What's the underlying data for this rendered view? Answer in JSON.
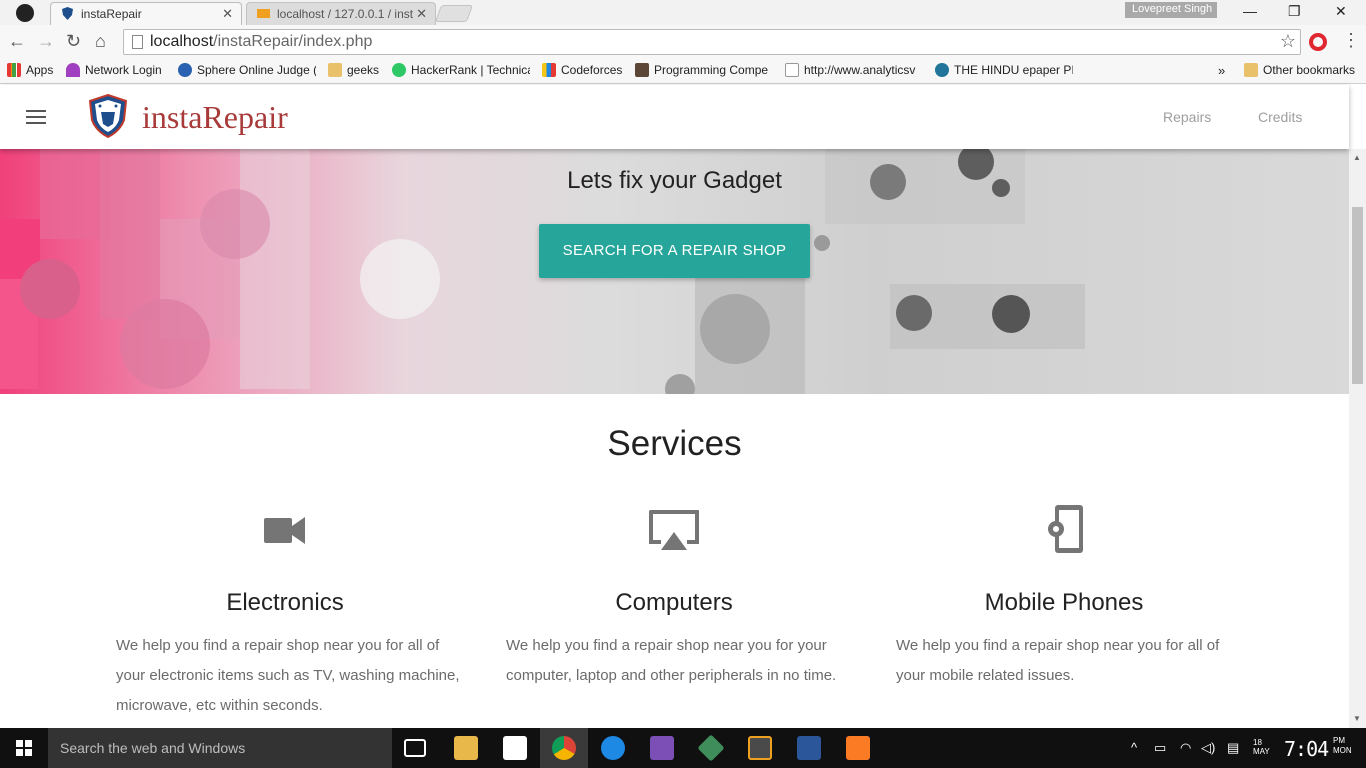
{
  "browser": {
    "tabs": [
      {
        "title": "instaRepair",
        "active": true
      },
      {
        "title": "localhost / 127.0.0.1 / inst",
        "active": false
      }
    ],
    "profile_name": "Lovepreet Singh",
    "url_host": "localhost",
    "url_path": "/instaRepair/index.php",
    "bookmarks": [
      "Apps",
      "Network Login",
      "Sphere Online Judge (",
      "geeks",
      "HackerRank | Technica",
      "Codeforces",
      "Programming Compe",
      "http://www.analyticsv",
      "THE HINDU epaper PI"
    ],
    "bookmarks_overflow": "»",
    "other_bookmarks": "Other bookmarks"
  },
  "site": {
    "brand": "instaRepair",
    "nav": {
      "repairs": "Repairs",
      "credits": "Credits"
    },
    "hero": {
      "title": "Lets fix your Gadget",
      "cta": "SEARCH FOR A REPAIR SHOP"
    },
    "services": {
      "title": "Services",
      "items": [
        {
          "icon": "video-camera-icon",
          "title": "Electronics",
          "text": "We help you find a repair shop near you for all of your electronic items such as TV, washing machine, microwave, etc within seconds."
        },
        {
          "icon": "airplay-icon",
          "title": "Computers",
          "text": "We help you find a repair shop near you for your computer, laptop and other peripherals in no time."
        },
        {
          "icon": "phone-settings-icon",
          "title": "Mobile Phones",
          "text": "We help you find a repair shop near you for all of your mobile related issues."
        }
      ]
    }
  },
  "taskbar": {
    "search_placeholder": "Search the web and Windows",
    "time": "7:04",
    "ampm": "PM",
    "day": "MON",
    "date_side": "18 MAY"
  },
  "colors": {
    "accent_teal": "#26a69a",
    "brand_red": "#a83a3a",
    "hero_pink": "#f0407a"
  }
}
